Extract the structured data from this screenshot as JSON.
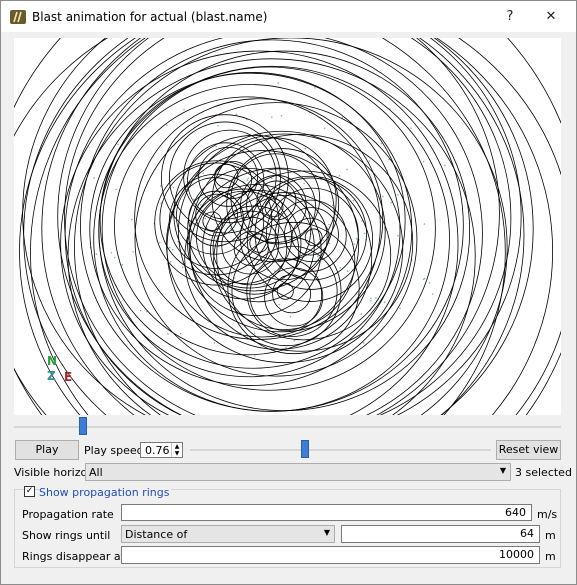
{
  "window": {
    "title": "Blast animation for actual (blast.name)",
    "help_label": "?",
    "close_label": "✕",
    "app_icon": "blast-app-icon"
  },
  "compass": {
    "north": "N",
    "z": "Z",
    "east": "E"
  },
  "timeline": {
    "progress": 0.12
  },
  "controls": {
    "play_label": "Play",
    "play_speed_label": "Play speed",
    "play_speed_value": "0.76",
    "speed_slider_level": 0.38,
    "reset_view_label": "Reset view"
  },
  "horizons": {
    "label": "Visible horizons",
    "selected_value": "All",
    "selected_count": "3 selected"
  },
  "rings": {
    "show_label": "Show propagation rings",
    "checked": true,
    "propagation_rate_label": "Propagation rate",
    "propagation_rate_value": "640",
    "propagation_rate_unit": "m/s",
    "show_until_label": "Show rings until",
    "show_until_mode": "Distance of",
    "show_until_value": "64",
    "show_until_unit": "m",
    "disappear_label": "Rings disappear after",
    "disappear_value": "10000",
    "disappear_unit": "m"
  },
  "colors": {
    "accent": "#3d7dd6",
    "compass_north": "#2e9c3a",
    "compass_z": "#2f8f9b",
    "compass_east": "#a82424",
    "link_text": "#1f4fbf"
  }
}
